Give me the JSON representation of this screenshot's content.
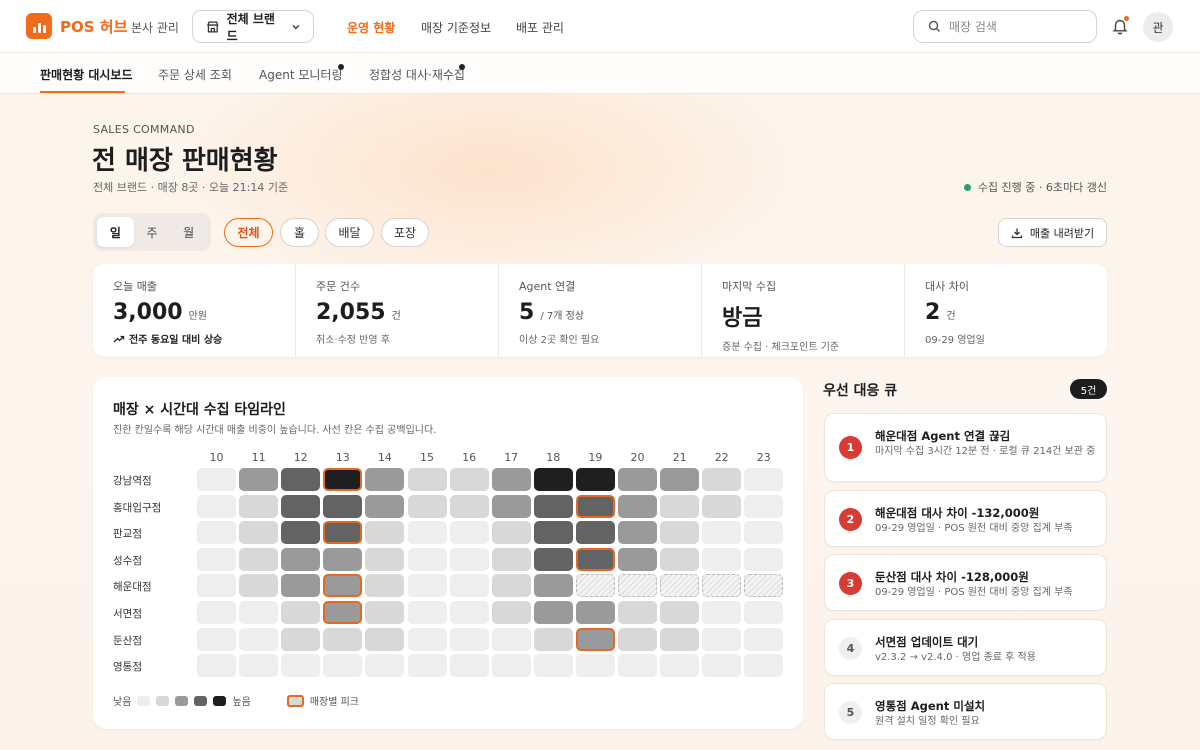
{
  "topbar": {
    "logo_text": "POS 허브",
    "org": "본사 관리",
    "brand_select": "전체 브랜드",
    "nav": [
      "운영 현황",
      "매장 기준정보",
      "배포 관리"
    ],
    "search_placeholder": "매장 검색",
    "avatar": "관"
  },
  "subtabs": [
    "판매현황 대시보드",
    "주문 상세 조회",
    "Agent 모니터링",
    "정합성 대사·재수집"
  ],
  "header": {
    "eyebrow": "SALES COMMAND",
    "title": "전 매장 판매현황",
    "subtitle": "전체 브랜드 · 매장 8곳 · 오늘 21:14 기준",
    "live": "수집 진행 중 · 6초마다 갱신"
  },
  "controls": {
    "period": [
      "일",
      "주",
      "월"
    ],
    "channels": [
      "전체",
      "홀",
      "배달",
      "포장"
    ],
    "download": "매출 내려받기"
  },
  "kpis": [
    {
      "label": "오늘 매출",
      "value": "3,000",
      "unit": "만원",
      "foot": "전주 동요일 대비 상승"
    },
    {
      "label": "주문 건수",
      "value": "2,055",
      "unit": "건",
      "foot": "취소·수정 반영 후"
    },
    {
      "label": "Agent 연결",
      "value": "5",
      "unit": "/ 7개 정상",
      "foot": "이상 2곳 확인 필요"
    },
    {
      "label": "마지막 수집",
      "value": "방금",
      "unit": "",
      "foot": "증분 수집 · 체크포인트 기준"
    },
    {
      "label": "대사 차이",
      "value": "2",
      "unit": "건",
      "foot": "09-29 영업일"
    }
  ],
  "heatmap": {
    "title": "매장 × 시간대 수집 타임라인",
    "desc": "진한 칸일수록 해당 시간대 매출 비중이 높습니다. 사선 칸은 수집 공백입니다.",
    "hours": [
      "10",
      "11",
      "12",
      "13",
      "14",
      "15",
      "16",
      "17",
      "18",
      "19",
      "20",
      "21",
      "22",
      "23"
    ],
    "stores": [
      "강남역점",
      "홍대입구점",
      "판교점",
      "성수점",
      "해운대점",
      "서면점",
      "둔산점",
      "영통점"
    ],
    "levels": [
      [
        1,
        3,
        4,
        5,
        3,
        2,
        2,
        3,
        5,
        5,
        3,
        3,
        2,
        1
      ],
      [
        1,
        2,
        4,
        4,
        3,
        2,
        2,
        3,
        4,
        4,
        3,
        2,
        2,
        1
      ],
      [
        1,
        2,
        4,
        4,
        2,
        1,
        1,
        2,
        4,
        4,
        3,
        2,
        1,
        1
      ],
      [
        1,
        2,
        3,
        3,
        2,
        1,
        1,
        2,
        4,
        4,
        3,
        2,
        1,
        1
      ],
      [
        1,
        2,
        3,
        3,
        2,
        1,
        1,
        2,
        3,
        -1,
        -1,
        -1,
        -1,
        -1
      ],
      [
        1,
        1,
        2,
        3,
        2,
        1,
        1,
        2,
        3,
        3,
        2,
        2,
        1,
        1
      ],
      [
        1,
        1,
        2,
        2,
        2,
        1,
        1,
        1,
        2,
        3,
        2,
        2,
        1,
        1
      ],
      [
        1,
        1,
        1,
        1,
        1,
        1,
        1,
        1,
        1,
        1,
        1,
        1,
        1,
        1
      ]
    ],
    "peaks": [
      [
        0,
        3
      ],
      [
        1,
        9
      ],
      [
        2,
        3
      ],
      [
        3,
        9
      ],
      [
        4,
        3
      ],
      [
        5,
        3
      ],
      [
        6,
        9
      ]
    ],
    "legend_low": "낮음",
    "legend_high": "높음",
    "legend_peak": "매장별 피크",
    "level_colors": [
      "#eeeeee",
      "#d8d8d8",
      "#9a9a9a",
      "#636363",
      "#1f1f1f"
    ]
  },
  "queue": {
    "title": "우선 대응 큐",
    "count": "5건",
    "items": [
      {
        "n": "1",
        "title": "해운대점 Agent 연결 끊김",
        "desc": "마지막 수집 3시간 12분 전 · 로컬 큐 214건 보관 중",
        "urgent": true
      },
      {
        "n": "2",
        "title": "해운대점 대사 차이 -132,000원",
        "desc": "09-29 영업일 · POS 원천 대비 중앙 집계 부족",
        "urgent": true
      },
      {
        "n": "3",
        "title": "둔산점 대사 차이 -128,000원",
        "desc": "09-29 영업일 · POS 원천 대비 중앙 집계 부족",
        "urgent": true
      },
      {
        "n": "4",
        "title": "서면점 업데이트 대기",
        "desc": "v2.3.2 → v2.4.0 · 영업 종료 후 적용",
        "urgent": false
      },
      {
        "n": "5",
        "title": "영통점 Agent 미설치",
        "desc": "원격 설치 일정 확인 필요",
        "urgent": false
      }
    ]
  }
}
